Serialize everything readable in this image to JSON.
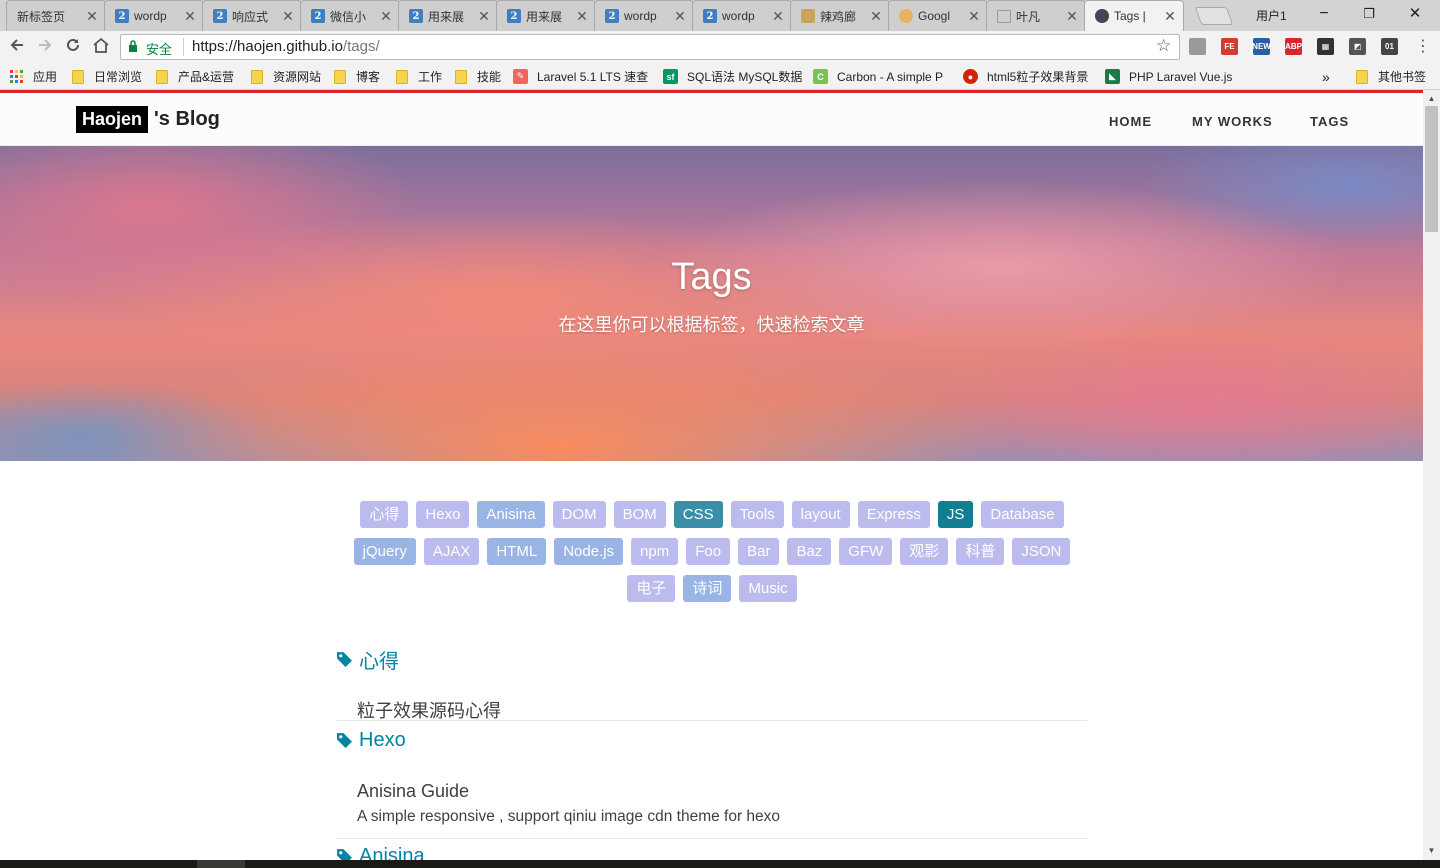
{
  "browser": {
    "tabs": [
      {
        "label": "新标签页",
        "icon": "none",
        "active": false
      },
      {
        "label": "wordp",
        "icon": "w",
        "active": false
      },
      {
        "label": "响应式",
        "icon": "w",
        "active": false
      },
      {
        "label": "微信小",
        "icon": "w",
        "active": false
      },
      {
        "label": "用来展",
        "icon": "w",
        "active": false
      },
      {
        "label": "用来展",
        "icon": "w",
        "active": false
      },
      {
        "label": "wordp",
        "icon": "w",
        "active": false
      },
      {
        "label": "wordp",
        "icon": "w",
        "active": false
      },
      {
        "label": "辣鸡廊",
        "icon": "gold",
        "active": false
      },
      {
        "label": "Googl",
        "icon": "round",
        "active": false
      },
      {
        "label": "叶凡",
        "icon": "plain",
        "active": false
      },
      {
        "label": "Tags |",
        "icon": "dark",
        "active": true
      }
    ],
    "user_label": "用户1",
    "window_buttons": {
      "minimize": "−",
      "restore": "❐",
      "close": "✕"
    },
    "secure_label": "安全",
    "url_host": "https://haojen.github.io",
    "url_rest": "/tags/",
    "bookmarks": [
      {
        "label": "应用",
        "icon": "apps-grid-icon"
      },
      {
        "label": "日常浏览",
        "icon": "folder"
      },
      {
        "label": "产品&运营",
        "icon": "folder"
      },
      {
        "label": "资源网站",
        "icon": "folder"
      },
      {
        "label": "博客",
        "icon": "folder"
      },
      {
        "label": "工作",
        "icon": "folder"
      },
      {
        "label": "技能",
        "icon": "folder"
      },
      {
        "label": "Laravel 5.1 LTS 速查",
        "icon": "laravel"
      },
      {
        "label": "SQL语法 MySQL数据",
        "icon": "sf"
      },
      {
        "label": "Carbon - A simple P",
        "icon": "carbon"
      },
      {
        "label": "html5粒子效果背景",
        "icon": "red"
      },
      {
        "label": "PHP Laravel Vue.js",
        "icon": "phpvue"
      }
    ],
    "bookmarks_overflow": "»",
    "other_bookmarks": "其他书签",
    "extensions": [
      {
        "name": "reader-icon",
        "text": "",
        "color": "#9a9a9a"
      },
      {
        "name": "fe-extension-icon",
        "text": "FE",
        "color": "#d23b2f"
      },
      {
        "name": "news-extension-icon",
        "text": "NEW",
        "color": "#2a5fa8"
      },
      {
        "name": "adblock-icon",
        "text": "ABP",
        "color": "#d8262c"
      },
      {
        "name": "qrcode-icon",
        "text": "▦",
        "color": "#333333"
      },
      {
        "name": "screenshot-extension-icon",
        "text": "◩",
        "color": "#555555"
      },
      {
        "name": "binary-extension-icon",
        "text": "01",
        "color": "#444444"
      }
    ]
  },
  "site": {
    "brand_box": "Haojen",
    "brand_rest": "'s Blog",
    "nav": [
      "HOME",
      "MY WORKS",
      "TAGS"
    ],
    "hero_title": "Tags",
    "hero_subtitle": "在这里你可以根据标签，快速检索文章"
  },
  "colors": {
    "tag_light": "#bbbbee",
    "tag_medium": "#9bb4e6",
    "tag_teal": "#3a8ea8",
    "tag_dark_teal": "#127e93",
    "accent": "#0085a1",
    "top_line": "#d9262c"
  },
  "tag_rows": [
    [
      {
        "label": "心得",
        "shade": "tag_light"
      },
      {
        "label": "Hexo",
        "shade": "tag_light"
      },
      {
        "label": "Anisina",
        "shade": "tag_medium"
      },
      {
        "label": "DOM",
        "shade": "tag_light"
      },
      {
        "label": "BOM",
        "shade": "tag_light"
      },
      {
        "label": "CSS",
        "shade": "tag_teal"
      },
      {
        "label": "Tools",
        "shade": "tag_light"
      },
      {
        "label": "layout",
        "shade": "tag_light"
      },
      {
        "label": "Express",
        "shade": "tag_light"
      },
      {
        "label": "JS",
        "shade": "tag_dark_teal"
      },
      {
        "label": "Database",
        "shade": "tag_light"
      }
    ],
    [
      {
        "label": "jQuery",
        "shade": "tag_medium"
      },
      {
        "label": "AJAX",
        "shade": "tag_light"
      },
      {
        "label": "HTML",
        "shade": "tag_medium"
      },
      {
        "label": "Node.js",
        "shade": "tag_medium"
      },
      {
        "label": "npm",
        "shade": "tag_light"
      },
      {
        "label": "Foo",
        "shade": "tag_light"
      },
      {
        "label": "Bar",
        "shade": "tag_light"
      },
      {
        "label": "Baz",
        "shade": "tag_light"
      },
      {
        "label": "GFW",
        "shade": "tag_light"
      },
      {
        "label": "观影",
        "shade": "tag_light"
      },
      {
        "label": "科普",
        "shade": "tag_light"
      },
      {
        "label": "JSON",
        "shade": "tag_light"
      }
    ],
    [
      {
        "label": "电子",
        "shade": "tag_light"
      },
      {
        "label": "诗词",
        "shade": "tag_medium"
      },
      {
        "label": "Music",
        "shade": "tag_light"
      }
    ]
  ],
  "sections": [
    {
      "tag": "心得",
      "posts": [
        {
          "title": "粒子效果源码心得",
          "subtitle": ""
        }
      ]
    },
    {
      "tag": "Hexo",
      "posts": [
        {
          "title": "Anisina Guide",
          "subtitle": "A simple responsive , support qiniu image cdn theme for hexo"
        }
      ]
    },
    {
      "tag": "Anisina",
      "posts": []
    }
  ]
}
